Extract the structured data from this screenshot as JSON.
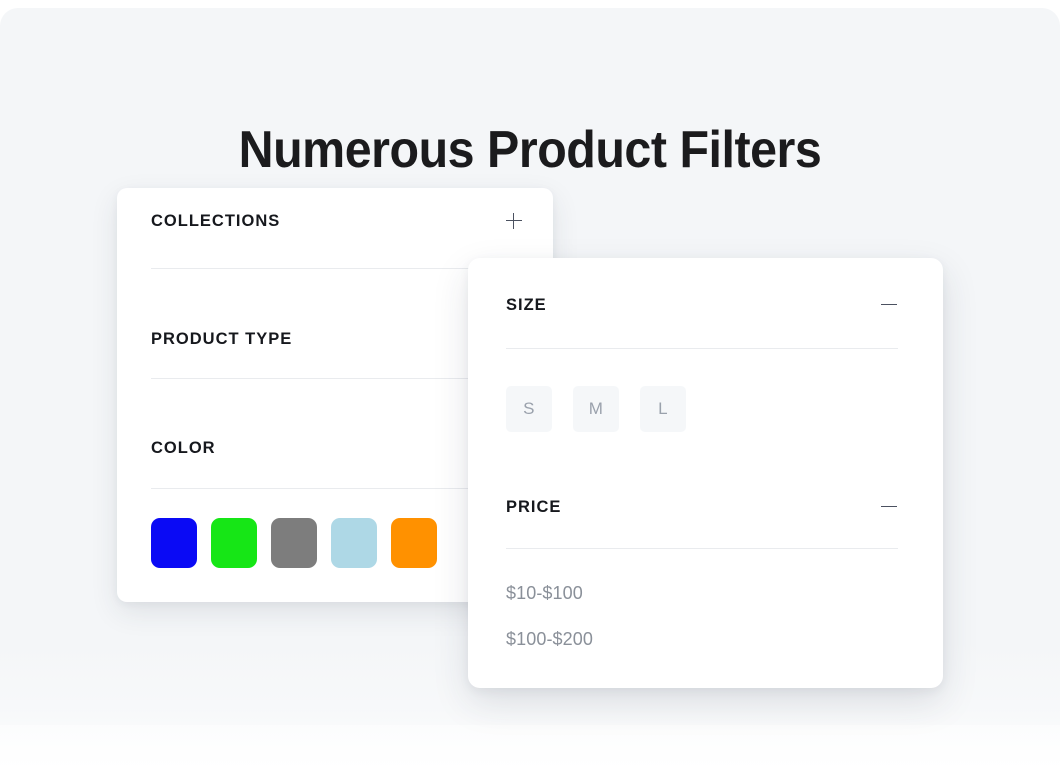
{
  "page": {
    "title": "Numerous Product Filters",
    "background_color": "#f4f6f8",
    "card_color": "#ffffff"
  },
  "collections_card": {
    "sections": [
      {
        "label": "COLLECTIONS",
        "toggle": "plus-icon",
        "expanded": false
      },
      {
        "label": "PRODUCT TYPE",
        "toggle": "none",
        "expanded": false
      },
      {
        "label": "COLOR",
        "toggle": "none",
        "expanded": true
      }
    ],
    "colors": [
      {
        "name": "blue",
        "hex": "#0a0af5"
      },
      {
        "name": "green",
        "hex": "#16e616"
      },
      {
        "name": "gray",
        "hex": "#7d7d7d"
      },
      {
        "name": "light-blue",
        "hex": "#aed8e6"
      },
      {
        "name": "orange",
        "hex": "#ff9100"
      }
    ]
  },
  "size_card": {
    "size_section": {
      "label": "SIZE",
      "toggle": "minus-icon",
      "expanded": true,
      "options": [
        "S",
        "M",
        "L"
      ]
    },
    "price_section": {
      "label": "PRICE",
      "toggle": "minus-icon",
      "expanded": true,
      "options": [
        "$10-$100",
        "$100-$200"
      ]
    }
  }
}
